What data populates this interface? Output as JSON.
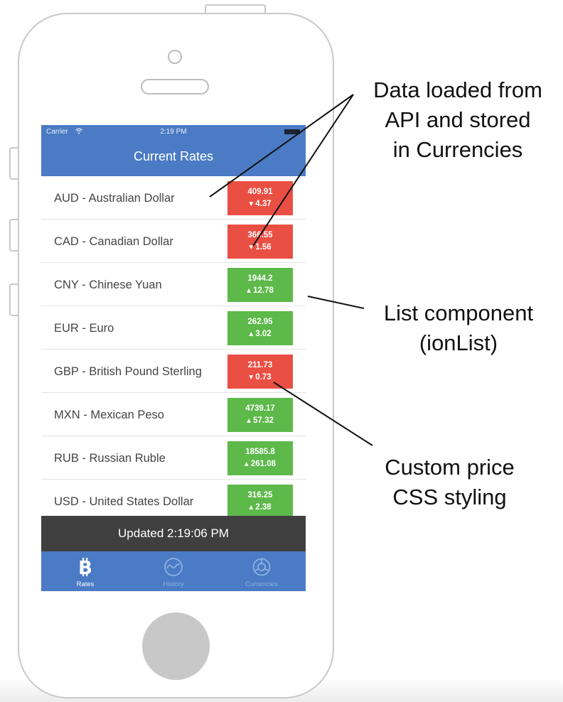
{
  "status_bar": {
    "carrier": "Carrier",
    "time": "2:19 PM"
  },
  "header": {
    "title": "Current Rates"
  },
  "rates": [
    {
      "label": "AUD - Australian Dollar",
      "value": "409.91",
      "change": "4.37",
      "direction": "down",
      "arrow": "▾"
    },
    {
      "label": "CAD - Canadian Dollar",
      "value": "366.55",
      "change": "1.56",
      "direction": "down",
      "arrow": "▾"
    },
    {
      "label": "CNY - Chinese Yuan",
      "value": "1944.2",
      "change": "12.78",
      "direction": "up",
      "arrow": "▴"
    },
    {
      "label": "EUR - Euro",
      "value": "262.95",
      "change": "3.02",
      "direction": "up",
      "arrow": "▴"
    },
    {
      "label": "GBP - British Pound Sterling",
      "value": "211.73",
      "change": "0.73",
      "direction": "down",
      "arrow": "▾"
    },
    {
      "label": "MXN - Mexican Peso",
      "value": "4739.17",
      "change": "57.32",
      "direction": "up",
      "arrow": "▴"
    },
    {
      "label": "RUB - Russian Ruble",
      "value": "18585.8",
      "change": "261.08",
      "direction": "up",
      "arrow": "▴"
    },
    {
      "label": "USD - United States Dollar",
      "value": "316.25",
      "change": "2.38",
      "direction": "up",
      "arrow": "▴"
    }
  ],
  "footer": {
    "updated": "Updated 2:19:06 PM"
  },
  "tabs": [
    {
      "label": "Rates",
      "icon": "bitcoin-icon",
      "active": true
    },
    {
      "label": "History",
      "icon": "history-chart-icon",
      "active": false
    },
    {
      "label": "Currencies",
      "icon": "gear-icon",
      "active": false
    }
  ],
  "annotations": {
    "data_loaded": [
      "Data loaded from",
      "API and stored",
      "in Currencies"
    ],
    "list_component": [
      "List component",
      "(ionList)"
    ],
    "custom_price": [
      "Custom price",
      "CSS styling"
    ]
  },
  "colors": {
    "header_blue": "#4a7bc4",
    "price_down": "#ea4f43",
    "price_up": "#5db94a",
    "footer_dark": "#3f3f3f",
    "tab_inactive": "#8fb0df"
  }
}
